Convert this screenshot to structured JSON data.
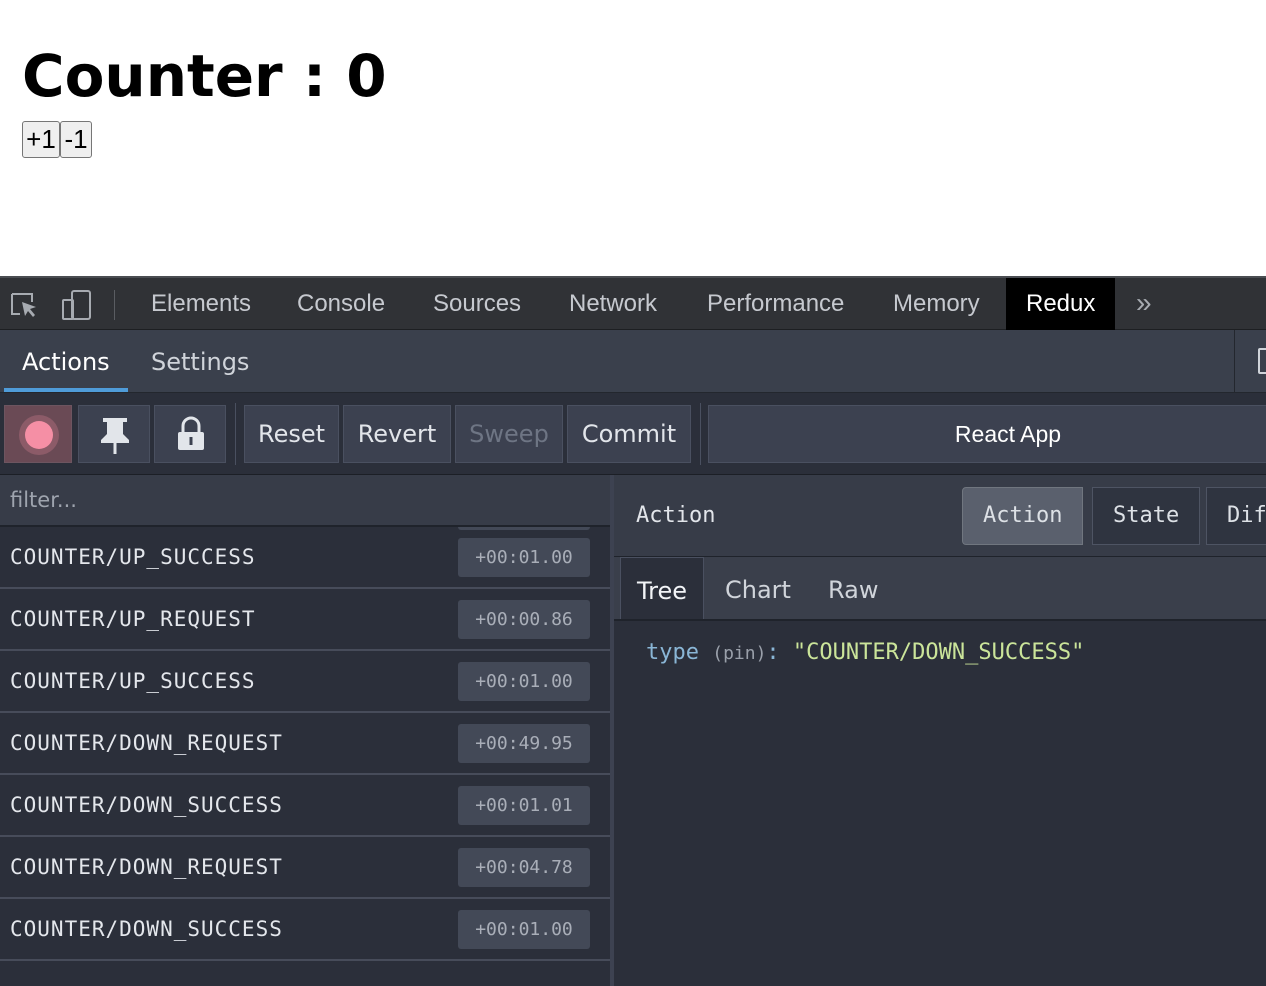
{
  "app": {
    "title": "Counter : 0",
    "increment_label": "+1",
    "decrement_label": "-1"
  },
  "devtools": {
    "tabs": [
      "Elements",
      "Console",
      "Sources",
      "Network",
      "Performance",
      "Memory",
      "Redux"
    ],
    "active_tab": "Redux",
    "more": "»"
  },
  "redux": {
    "tabs": {
      "actions": "Actions",
      "settings": "Settings"
    },
    "controls": {
      "reset": "Reset",
      "revert": "Revert",
      "sweep": "Sweep",
      "commit": "Commit",
      "instance": "React App"
    },
    "filter_placeholder": "filter...",
    "actions": [
      {
        "name": "COUNTER/UP_SUCCESS",
        "time": "+00:01.00"
      },
      {
        "name": "COUNTER/UP_REQUEST",
        "time": "+00:00.86"
      },
      {
        "name": "COUNTER/UP_SUCCESS",
        "time": "+00:01.00"
      },
      {
        "name": "COUNTER/DOWN_REQUEST",
        "time": "+00:49.95"
      },
      {
        "name": "COUNTER/DOWN_SUCCESS",
        "time": "+00:01.01"
      },
      {
        "name": "COUNTER/DOWN_REQUEST",
        "time": "+00:04.78"
      },
      {
        "name": "COUNTER/DOWN_SUCCESS",
        "time": "+00:01.00"
      }
    ],
    "inspector": {
      "title": "Action",
      "segments": {
        "action": "Action",
        "state": "State",
        "diff": "Diff"
      },
      "subtabs": {
        "tree": "Tree",
        "chart": "Chart",
        "raw": "Raw"
      },
      "tree": {
        "key": "type",
        "meta": "(pin)",
        "colon": ":",
        "value": "\"COUNTER/DOWN_SUCCESS\""
      }
    }
  },
  "colors": {
    "accent": "#4f9cd9",
    "record": "#f58fa5",
    "tree_value": "#cbe59a"
  }
}
